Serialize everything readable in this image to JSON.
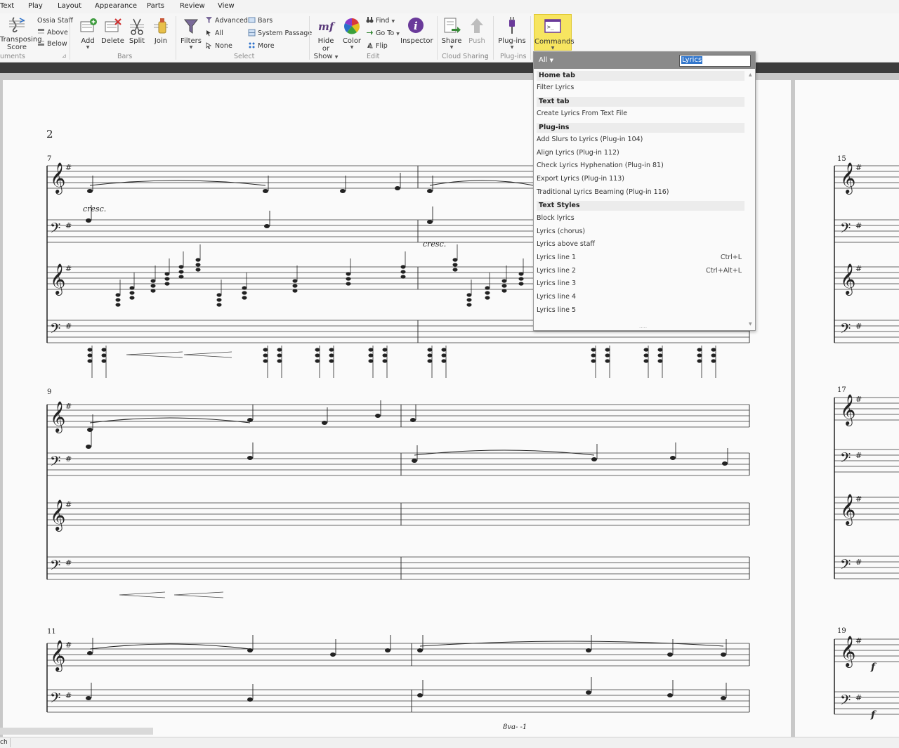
{
  "menu_tabs": [
    "Text",
    "Play",
    "Layout",
    "Appearance",
    "Parts",
    "Review",
    "View"
  ],
  "ribbon": {
    "instruments": {
      "transposing_label_1": "Transposing",
      "transposing_label_2": "Score",
      "ossia_staff": "Ossia Staff",
      "above": "Above",
      "below": "Below",
      "group": "uments"
    },
    "bars": {
      "add": "Add",
      "delete": "Delete",
      "split": "Split",
      "join": "Join",
      "group": "Bars"
    },
    "select": {
      "filters": "Filters",
      "advanced": "Advanced",
      "all": "All",
      "none": "None",
      "bars": "Bars",
      "system_passage": "System Passage",
      "more": "More",
      "group": "Select"
    },
    "edit": {
      "hide_or_1": "Hide or",
      "hide_or_2": "Show",
      "color": "Color",
      "find": "Find",
      "goto": "Go To",
      "flip": "Flip",
      "inspector": "Inspector",
      "group": "Edit"
    },
    "cloud": {
      "share": "Share",
      "push": "Push",
      "group": "Cloud Sharing"
    },
    "plugins": {
      "plugins": "Plug-ins",
      "group": "Plug-ins"
    },
    "commands": {
      "label": "Commands"
    }
  },
  "command_panel": {
    "filter_value": "All",
    "search_value": "Lyrics",
    "sections": [
      {
        "title": "Home tab",
        "items": [
          {
            "label": "Filter Lyrics",
            "shortcut": ""
          }
        ]
      },
      {
        "title": "Text tab",
        "items": [
          {
            "label": "Create Lyrics From Text File",
            "shortcut": ""
          }
        ]
      },
      {
        "title": "Plug-ins",
        "items": [
          {
            "label": "Add Slurs to Lyrics (Plug-in 104)",
            "shortcut": ""
          },
          {
            "label": "Align Lyrics (Plug-in 112)",
            "shortcut": ""
          },
          {
            "label": "Check Lyrics Hyphenation (Plug-in 81)",
            "shortcut": ""
          },
          {
            "label": "Export Lyrics (Plug-in 113)",
            "shortcut": ""
          },
          {
            "label": "Traditional Lyrics Beaming (Plug-in 116)",
            "shortcut": ""
          }
        ]
      },
      {
        "title": "Text Styles",
        "items": [
          {
            "label": "Block lyrics",
            "shortcut": ""
          },
          {
            "label": "Lyrics (chorus)",
            "shortcut": ""
          },
          {
            "label": "Lyrics above staff",
            "shortcut": ""
          },
          {
            "label": "Lyrics line 1",
            "shortcut": "Ctrl+L"
          },
          {
            "label": "Lyrics line 2",
            "shortcut": "Ctrl+Alt+L"
          },
          {
            "label": "Lyrics line 3",
            "shortcut": ""
          },
          {
            "label": "Lyrics line 4",
            "shortcut": ""
          },
          {
            "label": "Lyrics line 5",
            "shortcut": ""
          }
        ]
      }
    ]
  },
  "score": {
    "page_number": "2",
    "bar_numbers": [
      "7",
      "9",
      "11",
      "15",
      "17",
      "19"
    ],
    "dynamics": {
      "cresc": "cresc.",
      "forte": "f",
      "ottava": "8va- -1"
    }
  },
  "status": {
    "left_text": "ch"
  },
  "colors": {
    "commands_highlight": "#f7e560",
    "panel_header": "#8a8a8a",
    "ribbon_bg": "#f6f6f6"
  }
}
